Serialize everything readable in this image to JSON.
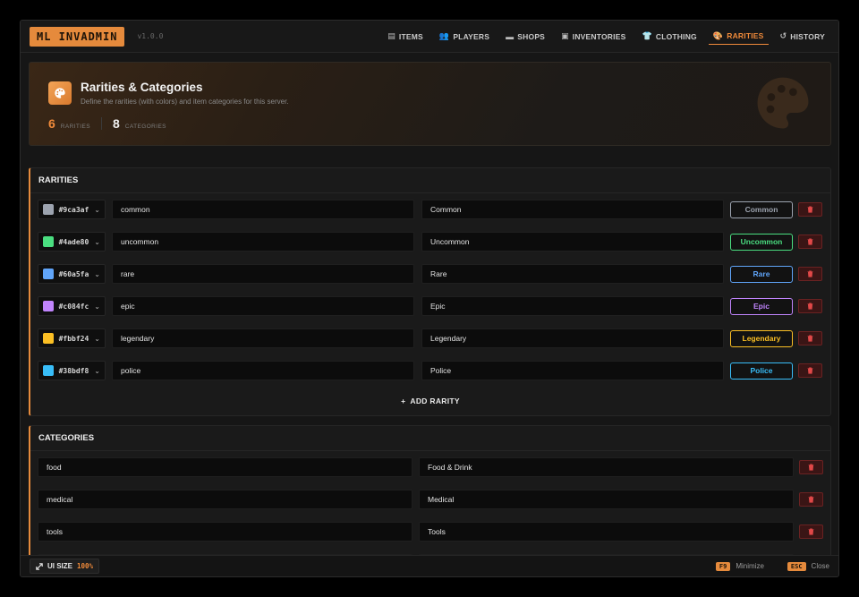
{
  "app": {
    "brand": "ML INVADMIN",
    "version": "v1.0.0"
  },
  "nav": [
    {
      "icon": "▤",
      "label": "ITEMS",
      "name": "nav-items",
      "active": false
    },
    {
      "icon": "👥",
      "label": "PLAYERS",
      "name": "nav-players",
      "active": false
    },
    {
      "icon": "▬",
      "label": "SHOPS",
      "name": "nav-shops",
      "active": false
    },
    {
      "icon": "▣",
      "label": "INVENTORIES",
      "name": "nav-inventories",
      "active": false
    },
    {
      "icon": "👕",
      "label": "CLOTHING",
      "name": "nav-clothing",
      "active": false
    },
    {
      "icon": "🎨",
      "label": "RARITIES",
      "name": "nav-rarities",
      "active": true
    },
    {
      "icon": "↺",
      "label": "HISTORY",
      "name": "nav-history",
      "active": false
    }
  ],
  "hero": {
    "title": "Rarities & Categories",
    "subtitle": "Define the rarities (with colors) and item categories for this server.",
    "rarity_count": "6",
    "rarity_label": "RARITIES",
    "category_count": "8",
    "category_label": "CATEGORIES",
    "icon": "palette-icon"
  },
  "rarities": {
    "heading": "RARITIES",
    "rows": [
      {
        "hex": "#9ca3af",
        "id": "common",
        "label": "Common",
        "color": "#9ca3af"
      },
      {
        "hex": "#4ade80",
        "id": "uncommon",
        "label": "Uncommon",
        "color": "#4ade80"
      },
      {
        "hex": "#60a5fa",
        "id": "rare",
        "label": "Rare",
        "color": "#60a5fa"
      },
      {
        "hex": "#c084fc",
        "id": "epic",
        "label": "Epic",
        "color": "#c084fc"
      },
      {
        "hex": "#fbbf24",
        "id": "legendary",
        "label": "Legendary",
        "color": "#fbbf24"
      },
      {
        "hex": "#38bdf8",
        "id": "police",
        "label": "Police",
        "color": "#38bdf8"
      }
    ],
    "add_label": "ADD RARITY"
  },
  "categories": {
    "heading": "CATEGORIES",
    "rows": [
      {
        "id": "food",
        "label": "Food & Drink"
      },
      {
        "id": "medical",
        "label": "Medical"
      },
      {
        "id": "tools",
        "label": "Tools"
      },
      {
        "id": "",
        "label": ""
      }
    ]
  },
  "footer": {
    "ui_size_label": "UI SIZE",
    "ui_size_value": "100%",
    "minimize_key": "F9",
    "minimize_label": "Minimize",
    "close_key": "ESC",
    "close_label": "Close"
  },
  "colors": {
    "accent": "#e58a3c",
    "danger": "#6a2222"
  }
}
